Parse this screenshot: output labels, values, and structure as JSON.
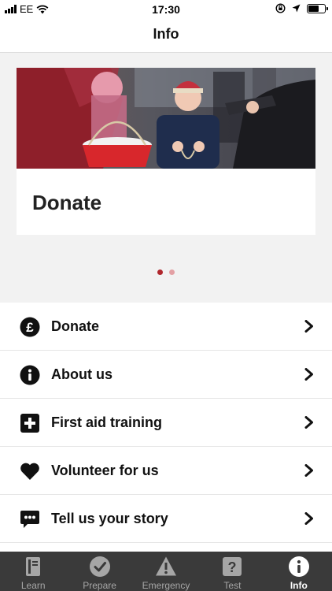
{
  "status_bar": {
    "carrier": "EE",
    "time": "17:30"
  },
  "nav": {
    "title": "Info"
  },
  "carousel": {
    "card_title": "Donate",
    "page_count": 2,
    "active_page": 1,
    "dot_active_color": "#b0272d",
    "dot_inactive_color": "#e3a0a4"
  },
  "menu": {
    "items": [
      {
        "label": "Donate",
        "icon": "pound-icon"
      },
      {
        "label": "About us",
        "icon": "info-icon"
      },
      {
        "label": "First aid training",
        "icon": "plus-icon"
      },
      {
        "label": "Volunteer for us",
        "icon": "heart-icon"
      },
      {
        "label": "Tell us your story",
        "icon": "speech-bubble-icon"
      }
    ]
  },
  "tabbar": {
    "active_tab": "Info",
    "tabs": [
      {
        "label": "Learn",
        "icon": "book-icon"
      },
      {
        "label": "Prepare",
        "icon": "checkmark-icon"
      },
      {
        "label": "Emergency",
        "icon": "warning-icon"
      },
      {
        "label": "Test",
        "icon": "question-icon"
      },
      {
        "label": "Info",
        "icon": "info-icon"
      }
    ]
  },
  "colors": {
    "brand_red": "#b0272d",
    "tabbar_bg": "#3a3a3a"
  }
}
